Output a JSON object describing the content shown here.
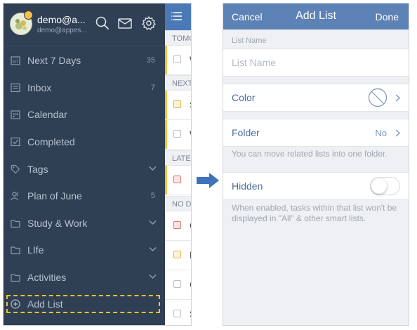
{
  "left": {
    "account": {
      "name": "demo@a...",
      "email": "demo@appes..."
    },
    "menu": [
      {
        "label": "Next 7 Days",
        "count": "35",
        "icon": "calendar-week-icon"
      },
      {
        "label": "Inbox",
        "count": "7",
        "icon": "inbox-icon"
      },
      {
        "label": "Calendar",
        "count": "",
        "icon": "calendar-icon"
      },
      {
        "label": "Completed",
        "count": "",
        "icon": "checkbox-icon"
      },
      {
        "label": "Tags",
        "count": "",
        "icon": "tag-icon"
      },
      {
        "label": "Plan of June",
        "count": "5",
        "icon": "shared-list-icon"
      },
      {
        "label": "Study & Work",
        "count": "",
        "icon": "folder-icon"
      },
      {
        "label": "LIfe",
        "count": "",
        "icon": "folder-icon"
      },
      {
        "label": "Activities",
        "count": "",
        "icon": "folder-icon"
      },
      {
        "label": "Add List",
        "count": "",
        "icon": "plus-circle-icon"
      }
    ],
    "tasks": {
      "sections": [
        "TOMO",
        "NEXT",
        "LATE",
        "NO DA"
      ],
      "rows": [
        "W",
        "S",
        "W",
        "",
        "C",
        "F",
        "C",
        "S"
      ]
    }
  },
  "right": {
    "nav": {
      "cancel": "Cancel",
      "title": "Add List",
      "done": "Done"
    },
    "list_name": {
      "section": "List Name",
      "placeholder": "List Name"
    },
    "color": {
      "label": "Color"
    },
    "folder": {
      "label": "Folder",
      "value": "No",
      "hint": "You can move related lists into one folder."
    },
    "hidden": {
      "label": "Hidden",
      "enabled": false,
      "hint": "When enabled, tasks within that list won't be displayed in \"All\" & other smart lists."
    }
  },
  "colors": {
    "drawer_bg": "#2f3f54",
    "nav_blue": "#5d82b5",
    "task_header_blue": "#4a79b5",
    "highlight_yellow": "#f0c02a",
    "arrow_blue": "#3f74b8"
  }
}
